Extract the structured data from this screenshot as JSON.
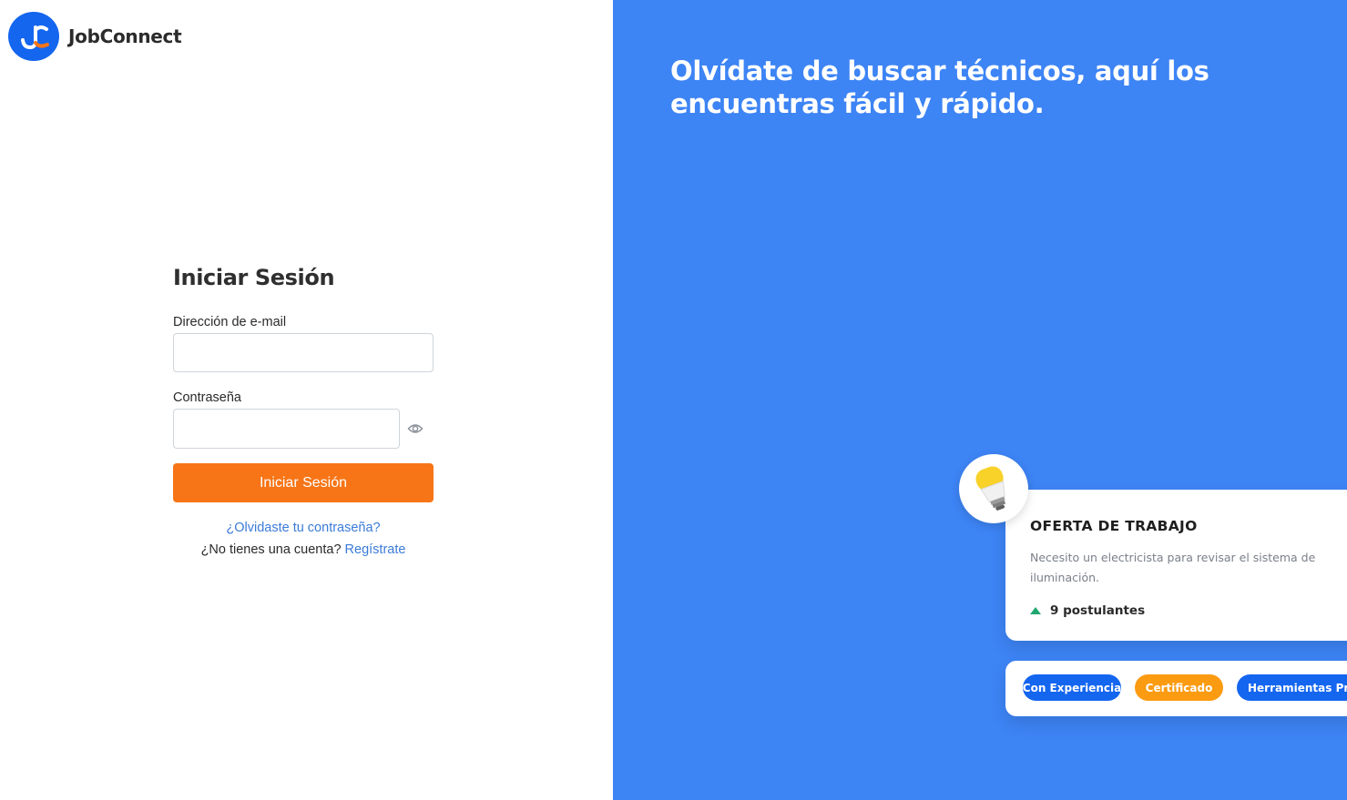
{
  "brand": {
    "name": "JobConnect",
    "logo_icon": "jc-logo-icon",
    "logo_color": "#1466ef"
  },
  "login": {
    "title": "Iniciar Sesión",
    "email_label": "Dirección de e-mail",
    "email_value": "",
    "password_label": "Contraseña",
    "password_value": "",
    "show_password_icon": "eye-icon",
    "submit_label": "Iniciar Sesión",
    "forgot_link": "¿Olvidaste tu contraseña?",
    "no_account_text": "¿No tienes una cuenta?",
    "register_link": "Regístrate"
  },
  "hero": {
    "headline": "Olvídate de buscar técnicos, aquí los encuentras fácil y rápido.",
    "background": "#3d84f5"
  },
  "job_card": {
    "icon": "lightbulb-icon",
    "title": "OFERTA DE TRABAJO",
    "description": "Necesito un electricista para revisar el sistema de iluminación.",
    "applicants": "9 postulantes",
    "trend_icon": "triangle-up-icon"
  },
  "tags": [
    {
      "label": "Con Experiencia",
      "color": "#1466ef"
    },
    {
      "label": "Certificado",
      "color": "#fb9b12"
    },
    {
      "label": "Herramientas Propias",
      "color": "#1466ef"
    }
  ],
  "colors": {
    "accent": "#f77517",
    "link": "#3b7bd8"
  }
}
